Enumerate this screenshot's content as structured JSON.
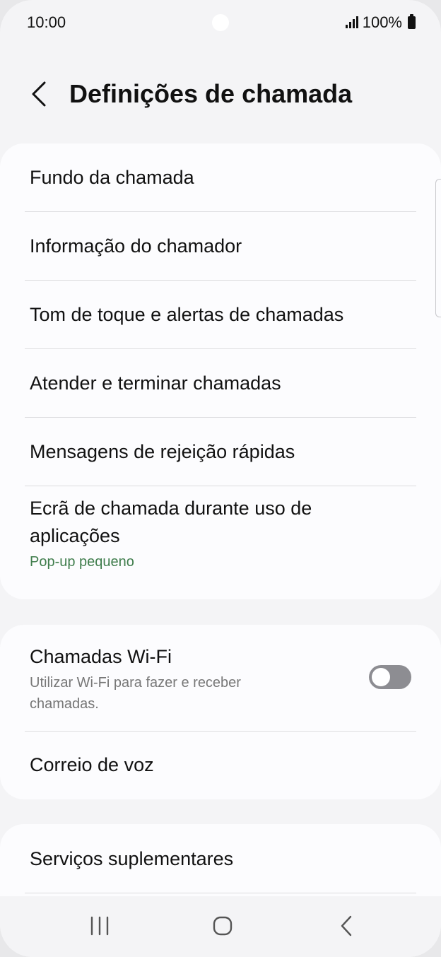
{
  "status_bar": {
    "time": "10:00",
    "battery": "100%"
  },
  "header": {
    "title": "Definições de chamada"
  },
  "group1": {
    "items": [
      {
        "title": "Fundo da chamada"
      },
      {
        "title": "Informação do chamador"
      },
      {
        "title": "Tom de toque e alertas de chamadas"
      },
      {
        "title": "Atender e terminar chamadas"
      },
      {
        "title": "Mensagens de rejeição rápidas"
      },
      {
        "title": "Ecrã de chamada durante uso de aplicações",
        "subtitle": "Pop-up pequeno"
      }
    ]
  },
  "group2": {
    "items": [
      {
        "title": "Chamadas Wi-Fi",
        "subtitle": "Utilizar Wi-Fi para fazer e receber chamadas.",
        "toggle_on": false
      },
      {
        "title": "Correio de voz"
      }
    ]
  },
  "group3": {
    "items": [
      {
        "title": "Serviços suplementares"
      }
    ]
  },
  "colors": {
    "accent_subtitle": "#3f7d4c",
    "toggle_off": "#8d8d92"
  },
  "icons": {
    "back": "chevron-left-icon",
    "nav_recents": "recents-icon",
    "nav_home": "home-icon",
    "nav_back": "back-icon"
  }
}
